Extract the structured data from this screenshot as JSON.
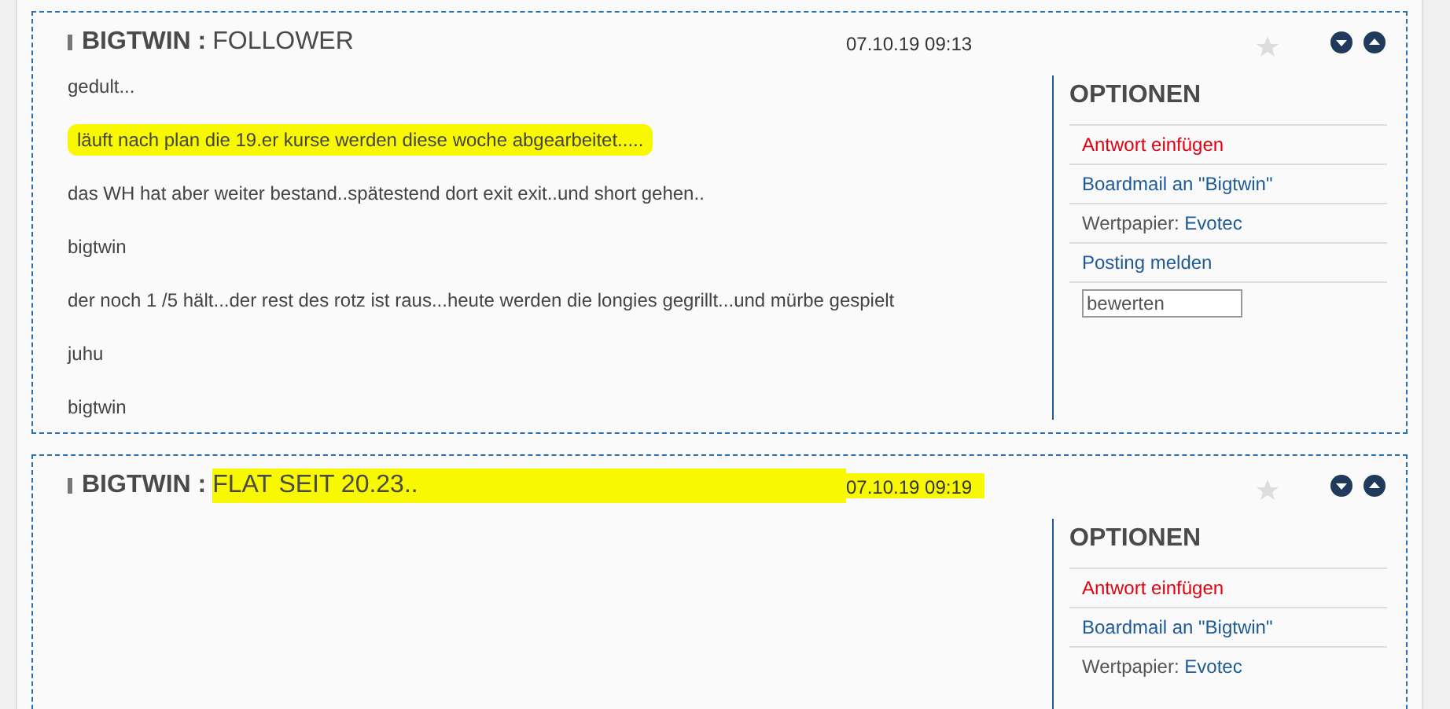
{
  "posts": [
    {
      "author": "BIGTWIN",
      "separator": ":",
      "title": "FOLLOWER",
      "date": "07.10.19 09:13",
      "highlighted": false,
      "paragraphs": [
        {
          "text": "gedult...",
          "highlighted": false
        },
        {
          "text": "läuft nach plan die 19.er kurse werden diese woche abgearbeitet.....",
          "highlighted": true
        },
        {
          "text": "das WH hat aber weiter bestand..spätestend dort exit exit..und short gehen..",
          "highlighted": false
        },
        {
          "text": "bigtwin",
          "highlighted": false
        },
        {
          "text": "der noch 1 /5 hält...der rest des rotz ist raus...heute werden die longies gegrillt...und mürbe gespielt",
          "highlighted": false
        },
        {
          "text": "juhu",
          "highlighted": false
        },
        {
          "text": "bigtwin",
          "highlighted": false
        }
      ],
      "options": {
        "heading": "OPTIONEN",
        "items": [
          {
            "kind": "reply",
            "text": "Antwort einfügen"
          },
          {
            "kind": "link",
            "text": "Boardmail an \"Bigtwin\""
          },
          {
            "kind": "security",
            "label": "Wertpapier:",
            "text": "Evotec"
          },
          {
            "kind": "link",
            "text": "Posting melden"
          },
          {
            "kind": "rating",
            "value": "bewerten"
          }
        ]
      }
    },
    {
      "author": "BIGTWIN",
      "separator": ":",
      "title": "FLAT SEIT 20.23..",
      "date": "07.10.19 09:19",
      "highlighted": true,
      "options": {
        "heading": "OPTIONEN",
        "items": [
          {
            "kind": "reply",
            "text": "Antwort einfügen"
          },
          {
            "kind": "link",
            "text": "Boardmail an \"Bigtwin\""
          },
          {
            "kind": "security",
            "label": "Wertpapier:",
            "text": "Evotec"
          }
        ]
      }
    }
  ]
}
